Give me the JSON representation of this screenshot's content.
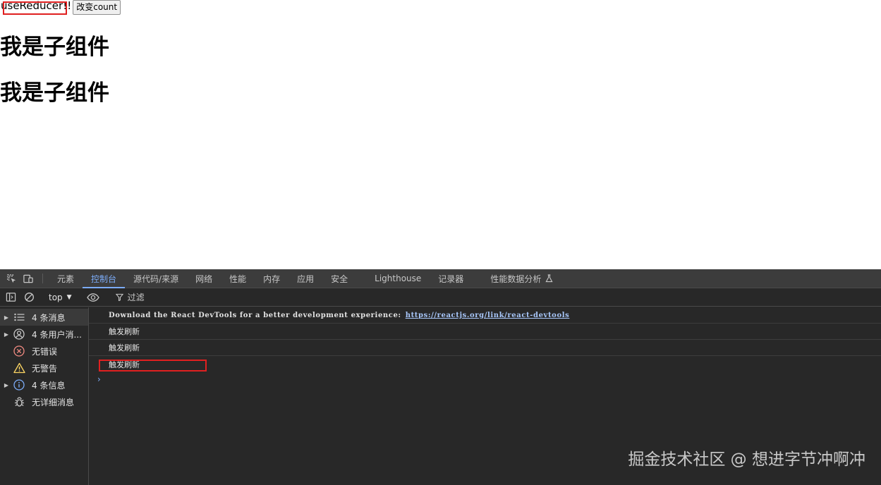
{
  "page": {
    "reducer_text": "useReducer!!",
    "count_button_label": "改变count",
    "child_headings": [
      "我是子组件",
      "我是子组件"
    ]
  },
  "devtools": {
    "tabs": [
      {
        "label": "元素",
        "active": false
      },
      {
        "label": "控制台",
        "active": true
      },
      {
        "label": "源代码/来源",
        "active": false
      },
      {
        "label": "网络",
        "active": false
      },
      {
        "label": "性能",
        "active": false
      },
      {
        "label": "内存",
        "active": false
      },
      {
        "label": "应用",
        "active": false
      },
      {
        "label": "安全",
        "active": false
      },
      {
        "label": "Lighthouse",
        "active": false
      },
      {
        "label": "记录器",
        "active": false
      },
      {
        "label": "性能数据分析",
        "active": false
      }
    ],
    "context_select": "top",
    "filter_label": "过滤",
    "sidebar": [
      {
        "label": "4 条消息",
        "icon": "list-icon",
        "expandable": true
      },
      {
        "label": "4 条用户消...",
        "icon": "user-icon",
        "expandable": true
      },
      {
        "label": "无错误",
        "icon": "error-icon",
        "expandable": false
      },
      {
        "label": "无警告",
        "icon": "warning-icon",
        "expandable": false
      },
      {
        "label": "4 条信息",
        "icon": "info-icon",
        "expandable": true
      },
      {
        "label": "无详细消息",
        "icon": "bug-icon",
        "expandable": false
      }
    ],
    "messages": [
      {
        "text": "Download the React DevTools for a better development experience:",
        "link": "https://reactjs.org/link/react-devtools"
      },
      {
        "text": "触发刷新"
      },
      {
        "text": "触发刷新"
      },
      {
        "text": "触发刷新"
      }
    ],
    "prompt_symbol": "›"
  },
  "watermark": "掘金技术社区 @ 想进字节冲啊冲",
  "colors": {
    "accent": "#7cacf8",
    "annotation": "#e02020",
    "devtools_bg": "#282828",
    "tabbar_bg": "#3c3c3c",
    "error": "#f28b82",
    "warning": "#fdd663",
    "info": "#7cacf8"
  }
}
